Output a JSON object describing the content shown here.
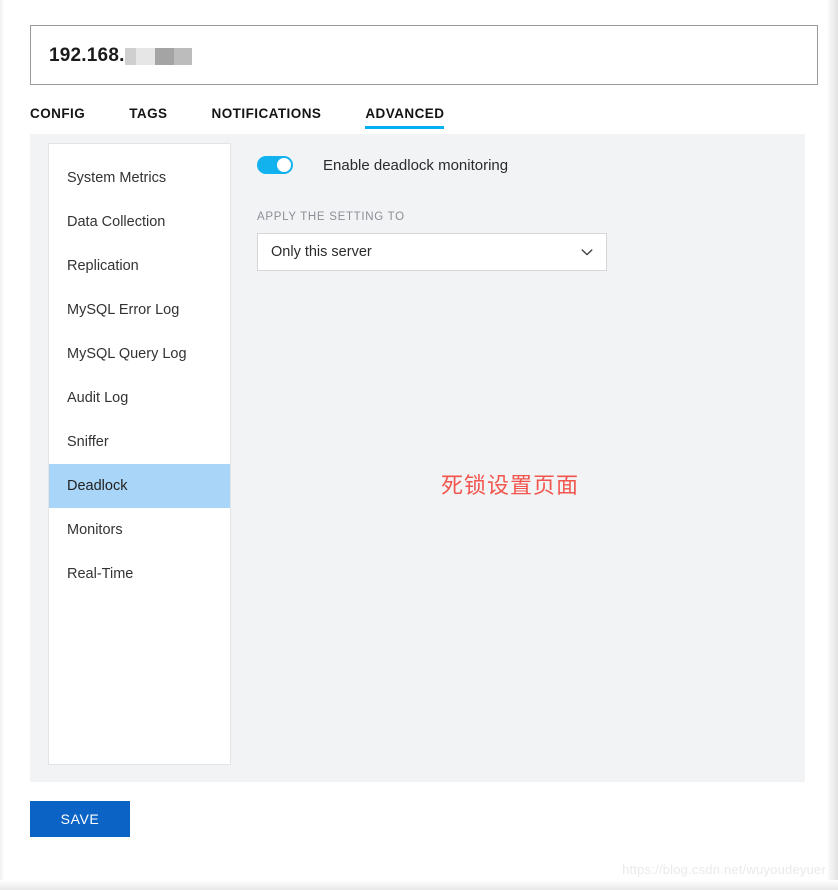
{
  "header": {
    "ip_prefix": "192.168.",
    "redaction_blocks": [
      {
        "width": 11,
        "color": "#cfcfcf"
      },
      {
        "width": 19,
        "color": "#e6e6e6"
      },
      {
        "width": 19,
        "color": "#a4a4a4"
      },
      {
        "width": 18,
        "color": "#bcbcbc"
      }
    ]
  },
  "tabs": [
    {
      "label": "CONFIG",
      "active": false
    },
    {
      "label": "TAGS",
      "active": false
    },
    {
      "label": "NOTIFICATIONS",
      "active": false
    },
    {
      "label": "ADVANCED",
      "active": true
    }
  ],
  "sidebar": {
    "items": [
      {
        "label": "System Metrics",
        "selected": false
      },
      {
        "label": "Data Collection",
        "selected": false
      },
      {
        "label": "Replication",
        "selected": false
      },
      {
        "label": "MySQL Error Log",
        "selected": false
      },
      {
        "label": "MySQL Query Log",
        "selected": false
      },
      {
        "label": "Audit Log",
        "selected": false
      },
      {
        "label": "Sniffer",
        "selected": false
      },
      {
        "label": "Deadlock",
        "selected": true
      },
      {
        "label": "Monitors",
        "selected": false
      },
      {
        "label": "Real-Time",
        "selected": false
      }
    ]
  },
  "settings": {
    "toggle": {
      "label": "Enable deadlock monitoring",
      "enabled": true
    },
    "apply_setting": {
      "label": "APPLY THE SETTING TO",
      "selected_value": "Only this server",
      "options": [
        "Only this server"
      ]
    }
  },
  "annotation": {
    "text": "死锁设置页面"
  },
  "footer": {
    "save_label": "SAVE",
    "watermark": "https://blog.csdn.net/wuyoudeyuer"
  },
  "colors": {
    "accent_cyan": "#00b0f0",
    "toggle_on": "#12b2ef",
    "selected_item": "#a9d5f8",
    "save_blue": "#0b63c5",
    "annotation_red": "#f2554d",
    "content_bg": "#f2f3f5"
  }
}
